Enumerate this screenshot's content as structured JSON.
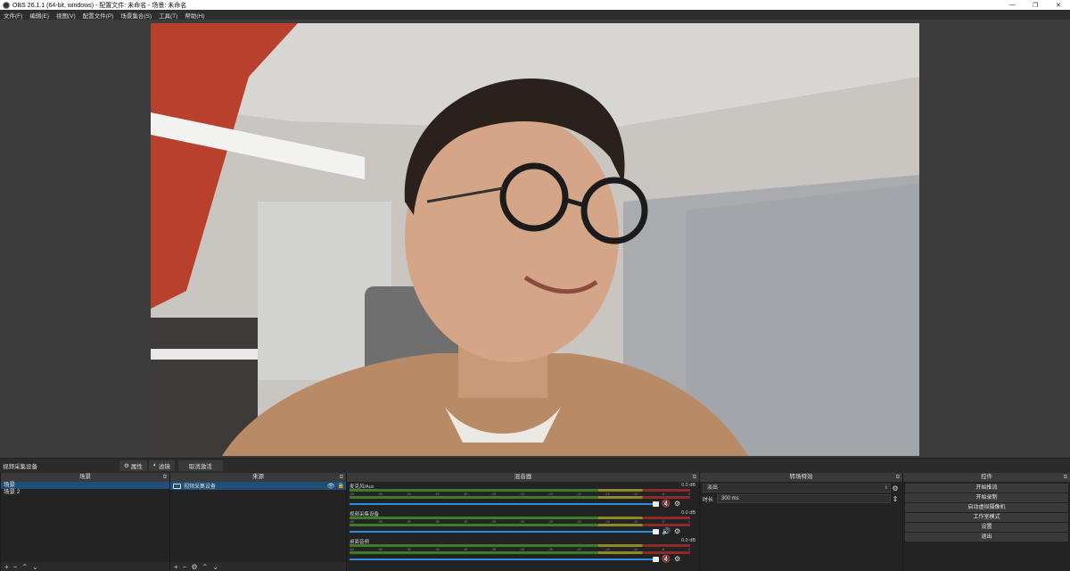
{
  "window": {
    "title": "OBS 26.1.1 (64-bit, windows) - 配置文件: 未命名 - 场景: 未命名",
    "minimize": "—",
    "maximize": "❐",
    "close": "✕"
  },
  "menu": [
    "文件(F)",
    "编辑(E)",
    "视图(V)",
    "配置文件(P)",
    "场景集合(S)",
    "工具(T)",
    "帮助(H)"
  ],
  "source_toolbar": {
    "current_source": "视频采集设备",
    "properties": "属性",
    "filters": "滤镜",
    "deactivate": "取消激活"
  },
  "scenes": {
    "title": "场景",
    "items": [
      "场景",
      "场景 2"
    ],
    "selected_index": 0
  },
  "sources": {
    "title": "来源",
    "items": [
      {
        "name": "视频采集设备",
        "visible": true,
        "locked": false
      }
    ]
  },
  "mixer": {
    "title": "混音器",
    "channels": [
      {
        "name": "麦克风/Aux",
        "level": "0.0 dB",
        "muted": true
      },
      {
        "name": "视频采集设备",
        "level": "0.0 dB",
        "muted": false
      },
      {
        "name": "桌面音频",
        "level": "0.0 dB",
        "muted": true
      }
    ],
    "scale": [
      "-60",
      "-55",
      "-50",
      "-45",
      "-40",
      "-35",
      "-30",
      "-25",
      "-20",
      "-15",
      "-10",
      "-5",
      "0"
    ]
  },
  "transitions": {
    "title": "转场特效",
    "selected": "淡出",
    "duration_label": "时长",
    "duration_value": "300 ms"
  },
  "controls": {
    "title": "控件",
    "buttons": [
      "开始推流",
      "开始录制",
      "启动虚拟摄像机",
      "工作室模式",
      "设置",
      "退出"
    ]
  },
  "icons": {
    "float": "⧉",
    "gear": "⚙",
    "eye": "👁",
    "lock": "🔒",
    "speaker_on": "🔊",
    "speaker_muted": "🔇",
    "add": "+",
    "remove": "−",
    "up": "⌃",
    "down": "⌄"
  },
  "colors": {
    "selection": "#1f4f76",
    "volume_slider": "#2e8bdf",
    "mute_red": "#e23a3a"
  }
}
